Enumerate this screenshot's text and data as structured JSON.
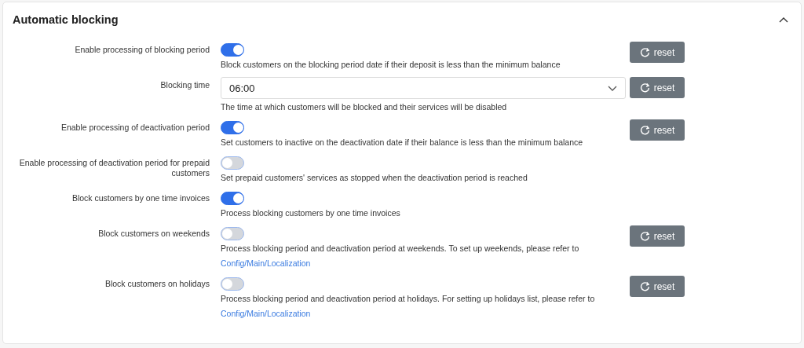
{
  "panel": {
    "title": "Automatic blocking",
    "expanded": true
  },
  "settings": [
    {
      "kind": "toggle",
      "label": "Enable processing of blocking period",
      "on": true,
      "description": "Block customers on the blocking period date if their deposit is less than the minimum balance",
      "reset": "reset"
    },
    {
      "kind": "select",
      "label": "Blocking time",
      "value": "06:00",
      "description": "The time at which customers will be blocked and their services will be disabled",
      "reset": "reset"
    },
    {
      "kind": "toggle",
      "label": "Enable processing of deactivation period",
      "on": true,
      "description": "Set customers to inactive on the deactivation date if their balance is less than the minimum balance",
      "reset": "reset"
    },
    {
      "kind": "toggle",
      "label": "Enable processing of deactivation period for prepaid customers",
      "on": false,
      "description": "Set prepaid customers' services as stopped when the deactivation period is reached"
    },
    {
      "kind": "toggle",
      "label": "Block customers by one time invoices",
      "on": true,
      "description": "Process blocking customers by one time invoices"
    },
    {
      "kind": "toggle",
      "label": "Block customers on weekends",
      "on": false,
      "description": "Process blocking period and deactivation period at weekends. To set up weekends, please refer to",
      "link": "Config/Main/Localization",
      "reset": "reset"
    },
    {
      "kind": "toggle",
      "label": "Block customers on holidays",
      "on": false,
      "description": "Process blocking period and deactivation period at holidays. For setting up holidays list, please refer to",
      "link": "Config/Main/Localization",
      "reset": "reset"
    }
  ]
}
